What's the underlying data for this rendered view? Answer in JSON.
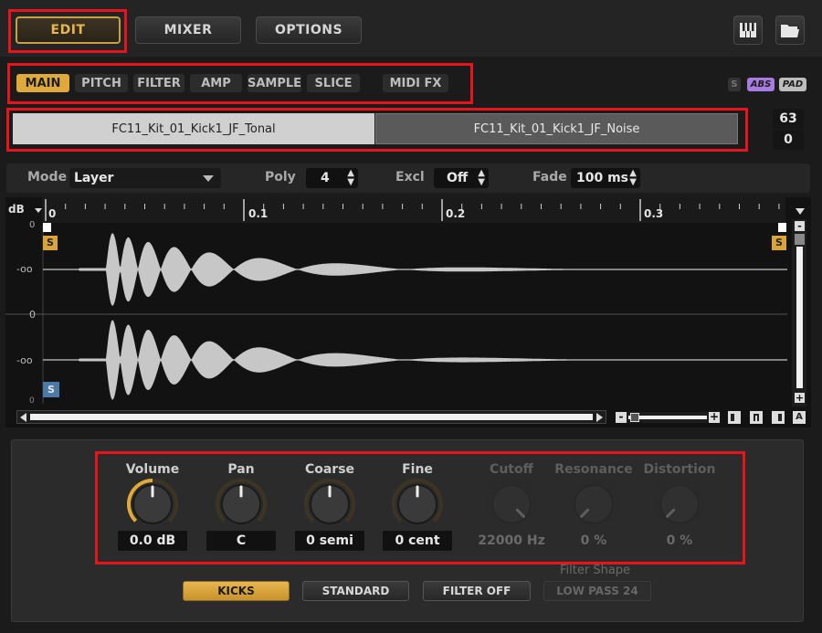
{
  "top": {
    "edit": "EDIT",
    "mixer": "MIXER",
    "options": "OPTIONS",
    "keyboard_icon": "piano-keys-icon",
    "folder_icon": "folder-open-icon"
  },
  "tabs": {
    "items": [
      "MAIN",
      "PITCH",
      "FILTER",
      "AMP",
      "SAMPLE",
      "SLICE",
      "MIDI FX"
    ],
    "active": "MAIN"
  },
  "tags": {
    "s": "S",
    "abs": "ABS",
    "pad": "PAD"
  },
  "layers": {
    "left": "FC11_Kit_01_Kick1_JF_Tonal",
    "right": "FC11_Kit_01_Kick1_JF_Noise",
    "note": "63",
    "vel": "0"
  },
  "mode_row": {
    "mode_label": "Mode",
    "mode_value": "Layer",
    "poly_label": "Poly",
    "poly_value": "4",
    "excl_label": "Excl",
    "excl_value": "Off",
    "fade_label": "Fade",
    "fade_value": "100 ms"
  },
  "waveform": {
    "db_unit": "dB",
    "ruler": [
      "0",
      "0.1",
      "0.2",
      "0.3"
    ],
    "db_ticks": [
      "0",
      "-oo",
      "0",
      "-oo",
      "0"
    ],
    "start_marker": "S",
    "end_marker": "S",
    "loop_marker": "S"
  },
  "zoom_buttons": [
    "-",
    "+"
  ],
  "knobs": [
    {
      "label": "Volume",
      "value": "0.0 dB",
      "dim": false,
      "amount": 0.5
    },
    {
      "label": "Pan",
      "value": "C",
      "dim": false,
      "amount": 0.5
    },
    {
      "label": "Coarse",
      "value": "0 semi",
      "dim": false,
      "amount": 0.5
    },
    {
      "label": "Fine",
      "value": "0 cent",
      "dim": false,
      "amount": 0.5
    },
    {
      "label": "Cutoff",
      "value": "22000 Hz",
      "dim": true,
      "amount": 1.0
    },
    {
      "label": "Resonance",
      "value": "0 %",
      "dim": true,
      "amount": 0.0
    },
    {
      "label": "Distortion",
      "value": "0 %",
      "dim": true,
      "amount": 0.0
    }
  ],
  "filter_shape_label": "Filter Shape",
  "presets": [
    {
      "label": "KICKS",
      "state": "active"
    },
    {
      "label": "STANDARD",
      "state": "normal"
    },
    {
      "label": "FILTER OFF",
      "state": "normal"
    },
    {
      "label": "LOW PASS 24",
      "state": "dim"
    }
  ],
  "colors": {
    "accent": "#e0a93b",
    "highlight": "#e8141b",
    "waveform": "#c7c7c7"
  }
}
